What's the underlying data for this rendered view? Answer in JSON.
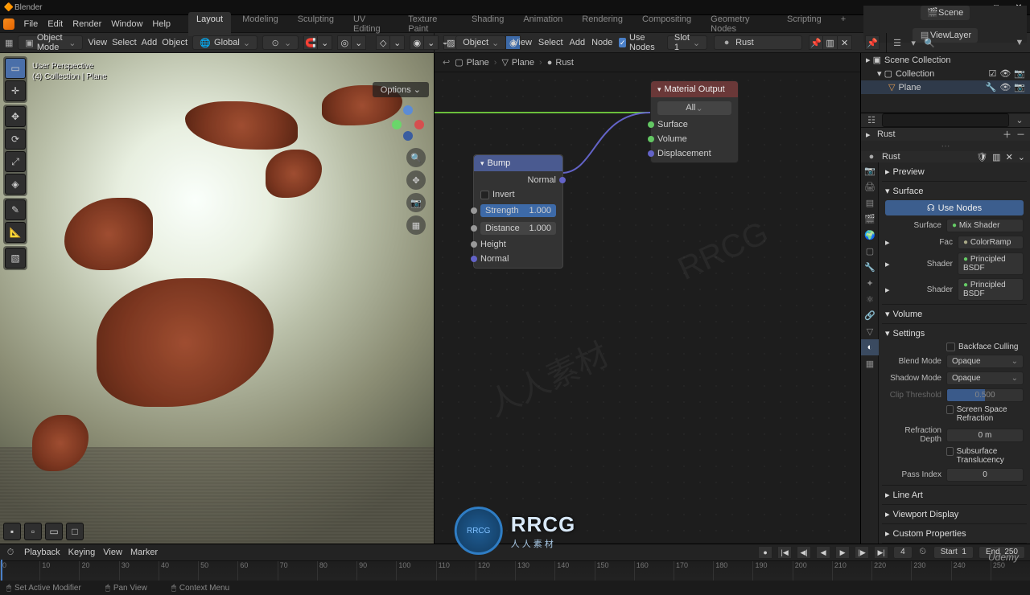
{
  "titlebar": {
    "app": "Blender"
  },
  "topmenu": {
    "items": [
      "File",
      "Edit",
      "Render",
      "Window",
      "Help"
    ],
    "workspaces": [
      "Layout",
      "Modeling",
      "Sculpting",
      "UV Editing",
      "Texture Paint",
      "Shading",
      "Animation",
      "Rendering",
      "Compositing",
      "Geometry Nodes",
      "Scripting"
    ],
    "active_ws": 0,
    "scene": "Scene",
    "viewlayer": "ViewLayer"
  },
  "hdr3d": {
    "mode": "Object Mode",
    "menus": [
      "View",
      "Select",
      "Add",
      "Object"
    ],
    "orientation": "Global"
  },
  "hdrshader": {
    "type": "Object",
    "menus": [
      "View",
      "Select",
      "Add",
      "Node"
    ],
    "use_nodes": "Use Nodes",
    "slot": "Slot 1",
    "material": "Rust"
  },
  "overlay": {
    "line1": "User Perspective",
    "line2": "(4) Collection | Plane",
    "options": "Options"
  },
  "breadcrumb": [
    "Plane",
    "Plane",
    "Rust"
  ],
  "node_bump": {
    "title": "Bump",
    "invert": "Invert",
    "strength": "Strength",
    "strength_v": "1.000",
    "distance": "Distance",
    "distance_v": "1.000",
    "height": "Height",
    "normal": "Normal",
    "out": "Normal"
  },
  "node_out": {
    "title": "Material Output",
    "target": "All",
    "surface": "Surface",
    "volume": "Volume",
    "disp": "Displacement"
  },
  "outliner": {
    "root": "Scene Collection",
    "coll": "Collection",
    "obj": "Plane"
  },
  "mat": {
    "name": "Rust"
  },
  "props": {
    "preview": "Preview",
    "surface": "Surface",
    "use_nodes": "Use Nodes",
    "surface_lbl": "Surface",
    "surface_val": "Mix Shader",
    "fac_lbl": "Fac",
    "fac_val": "ColorRamp",
    "sh1_lbl": "Shader",
    "sh1_val": "Principled BSDF",
    "sh2_lbl": "Shader",
    "sh2_val": "Principled BSDF",
    "volume": "Volume",
    "settings": "Settings",
    "backface": "Backface Culling",
    "blend_lbl": "Blend Mode",
    "blend_val": "Opaque",
    "shadow_lbl": "Shadow Mode",
    "shadow_val": "Opaque",
    "clip_lbl": "Clip Threshold",
    "clip_val": "0.500",
    "ssr": "Screen Space Refraction",
    "refr_lbl": "Refraction Depth",
    "refr_val": "0 m",
    "sss": "Subsurface Translucency",
    "pass_lbl": "Pass Index",
    "pass_val": "0",
    "lineart": "Line Art",
    "vpdisplay": "Viewport Display",
    "custom": "Custom Properties"
  },
  "timeline": {
    "menus": [
      "Playback",
      "Keying",
      "View",
      "Marker"
    ],
    "ticks": [
      "0",
      "10",
      "20",
      "30",
      "40",
      "50",
      "60",
      "70",
      "80",
      "90",
      "100",
      "110",
      "120",
      "130",
      "140",
      "150",
      "160",
      "170",
      "180",
      "190",
      "200",
      "210",
      "220",
      "230",
      "240",
      "250"
    ],
    "cur_idx": 0,
    "frame": "4",
    "start_lbl": "Start",
    "start_v": "1",
    "end_lbl": "End",
    "end_v": "250"
  },
  "status": {
    "a": "Set Active Modifier",
    "b": "Pan View",
    "c": "Context Menu"
  },
  "brand": {
    "name": "RRCG",
    "sub": "人人素材"
  },
  "udemy": "Udemy"
}
